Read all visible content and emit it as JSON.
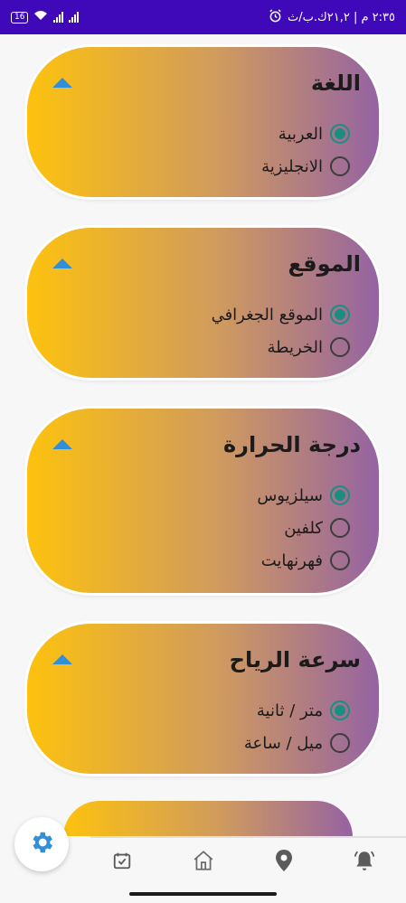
{
  "status_bar": {
    "battery": "16",
    "time_info": "٢:٣٥ م | ٢١,٢ك.ب/ث"
  },
  "cards": [
    {
      "title": "اللغة",
      "options": [
        {
          "label": "العربية",
          "checked": true
        },
        {
          "label": "الانجليزية",
          "checked": false
        }
      ]
    },
    {
      "title": "الموقع",
      "options": [
        {
          "label": "الموقع الجغرافي",
          "checked": true
        },
        {
          "label": "الخريطة",
          "checked": false
        }
      ]
    },
    {
      "title": "درجة الحرارة",
      "options": [
        {
          "label": "سيلزيوس",
          "checked": true
        },
        {
          "label": "كلفين",
          "checked": false
        },
        {
          "label": "فهرنهايت",
          "checked": false
        }
      ]
    },
    {
      "title": "سرعة الرياح",
      "options": [
        {
          "label": "متر / ثانية",
          "checked": true
        },
        {
          "label": "ميل / ساعة",
          "checked": false
        }
      ]
    }
  ],
  "bottom_nav": {
    "items": [
      "settings-icon",
      "calendar-check-icon",
      "home-icon",
      "location-pin-icon",
      "alert-bell-icon"
    ],
    "active": "settings-icon"
  },
  "colors": {
    "status_bar": "#3f09ba",
    "gradient_start": "#fdc20e",
    "gradient_end": "#9563a2",
    "radio_checked": "#1a8f80",
    "accent_blue": "#2f8fd8"
  }
}
